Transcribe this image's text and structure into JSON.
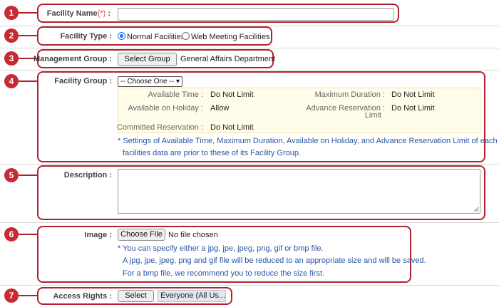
{
  "facility_name": {
    "label": "Facility Name",
    "required_mark": "(*)",
    "colon": ":",
    "value": ""
  },
  "facility_type": {
    "label": "Facility Type",
    "options": [
      "Normal Facilities",
      "Web Meeting Facilities"
    ],
    "selected": "Normal Facilities"
  },
  "management_group": {
    "label": "Management Group",
    "button": "Select Group",
    "value": "General Affairs Department"
  },
  "facility_group": {
    "label": "Facility Group",
    "select_value": "-- Choose One --",
    "available_time_label": "Available Time",
    "available_time_value": "Do Not Limit",
    "maximum_duration_label": "Maximum Duration",
    "maximum_duration_value": "Do Not Limit",
    "available_on_holiday_label": "Available on Holiday",
    "available_on_holiday_value": "Allow",
    "advance_reservation_label_1": "Advance Reservation",
    "advance_reservation_label_2": "Limit",
    "advance_reservation_value": "Do Not Limit",
    "committed_reservation_label": "Committed Reservation",
    "committed_reservation_value": "Do Not Limit",
    "note_1": "* Settings of Available Time, Maximum Duration, Available on Holiday, and Advance Reservation Limit of each",
    "note_2": "facilities data are prior to these of its Facility Group."
  },
  "description": {
    "label": "Description",
    "value": ""
  },
  "image": {
    "label": "Image",
    "button": "Choose File",
    "status": "No file chosen",
    "note_1": "* You can specify either a jpg, jpe, jpeg, png, gif or bmp file.",
    "note_2": "A jpg, jpe, jpeg, png and gif file will be reduced to an appropriate size and will be saved.",
    "note_3": "For a bmp file, we recommend you to reduce the size first."
  },
  "access_rights": {
    "label": "Access Rights",
    "button": "Select",
    "value": "Everyone (All Us..."
  },
  "callouts": [
    "1",
    "2",
    "3",
    "4",
    "5",
    "6",
    "7"
  ],
  "colors": {
    "callout": "#c62b34",
    "note": "#2957a4",
    "required": "#e0402a",
    "info_box": "#fffdea"
  }
}
